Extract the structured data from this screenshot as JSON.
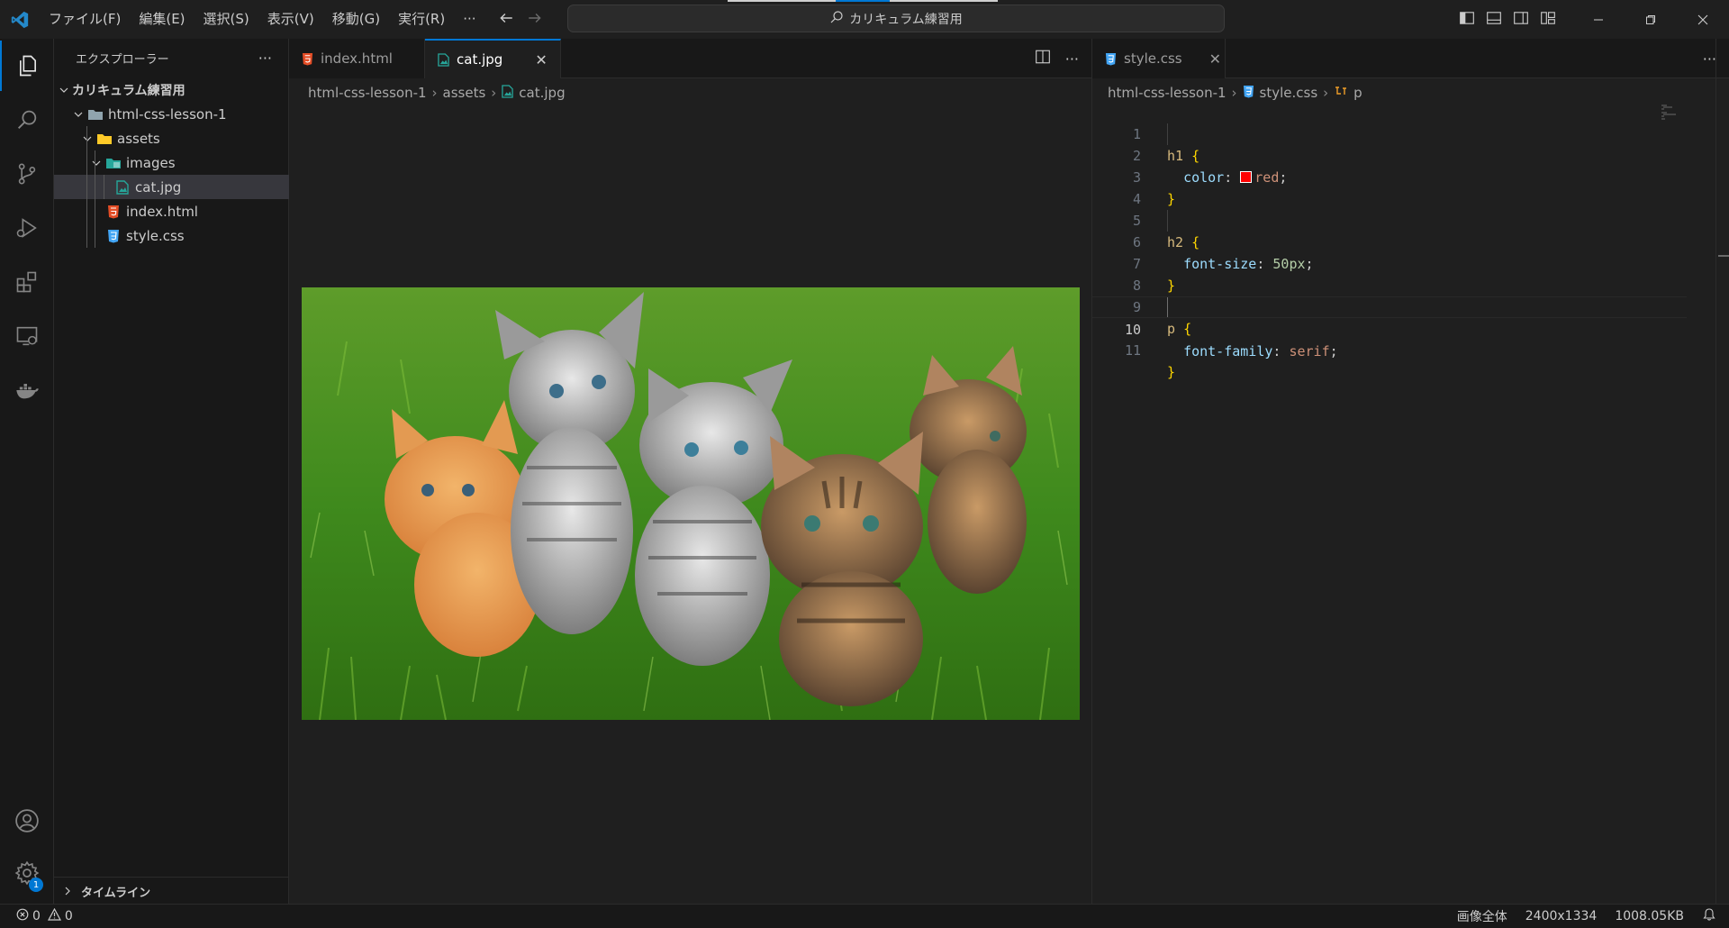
{
  "menu": [
    "ファイル(F)",
    "編集(E)",
    "選択(S)",
    "表示(V)",
    "移動(G)",
    "実行(R)"
  ],
  "menu_more": "···",
  "command_center": {
    "label": "カリキュラム練習用"
  },
  "explorer": {
    "title": "エクスプローラー",
    "more": "···",
    "workspace": "カリキュラム練習用",
    "tree": {
      "project": "html-css-lesson-1",
      "assets": "assets",
      "images": "images",
      "cat": "cat.jpg",
      "index": "index.html",
      "style": "style.css"
    },
    "timeline": "タイムライン"
  },
  "editor_left": {
    "tabs": [
      {
        "label": "index.html",
        "icon": "html-file-icon"
      },
      {
        "label": "cat.jpg",
        "icon": "image-file-icon"
      }
    ],
    "close_glyph": "✕",
    "actions_more": "···",
    "breadcrumb": [
      "html-css-lesson-1",
      "assets",
      "cat.jpg"
    ],
    "image_description_icon": "kitten-photo"
  },
  "editor_right": {
    "tab": {
      "label": "style.css",
      "icon": "css-file-icon"
    },
    "close_glyph": "✕",
    "actions_more": "···",
    "breadcrumb": [
      "html-css-lesson-1",
      "style.css",
      "p"
    ],
    "current_line": 10,
    "lines": [
      {
        "n": "1"
      },
      {
        "n": "2"
      },
      {
        "n": "3"
      },
      {
        "n": "4"
      },
      {
        "n": "5"
      },
      {
        "n": "6"
      },
      {
        "n": "7"
      },
      {
        "n": "8"
      },
      {
        "n": "9"
      },
      {
        "n": "10"
      },
      {
        "n": "11"
      }
    ],
    "code": {
      "l1_sel": "h1",
      "l1_brace": "{",
      "l2_prop": "color",
      "l2_val": "red",
      "l3_brace": "}",
      "l5_sel": "h2",
      "l5_brace": "{",
      "l6_prop": "font-size",
      "l6_val": "50px",
      "l7_brace": "}",
      "l9_sel": "p",
      "l9_brace": "{",
      "l10_prop": "font-family",
      "l10_val": "serif",
      "l11_brace": "}"
    },
    "swatch_color": "#ff0000"
  },
  "status": {
    "errors": "0",
    "warnings": "0",
    "zoom": "画像全体",
    "dimensions": "2400x1334",
    "size": "1008.05KB"
  },
  "colors": {
    "accent": "#0078d4",
    "background": "#1f1f1f",
    "sidebar": "#181818"
  }
}
